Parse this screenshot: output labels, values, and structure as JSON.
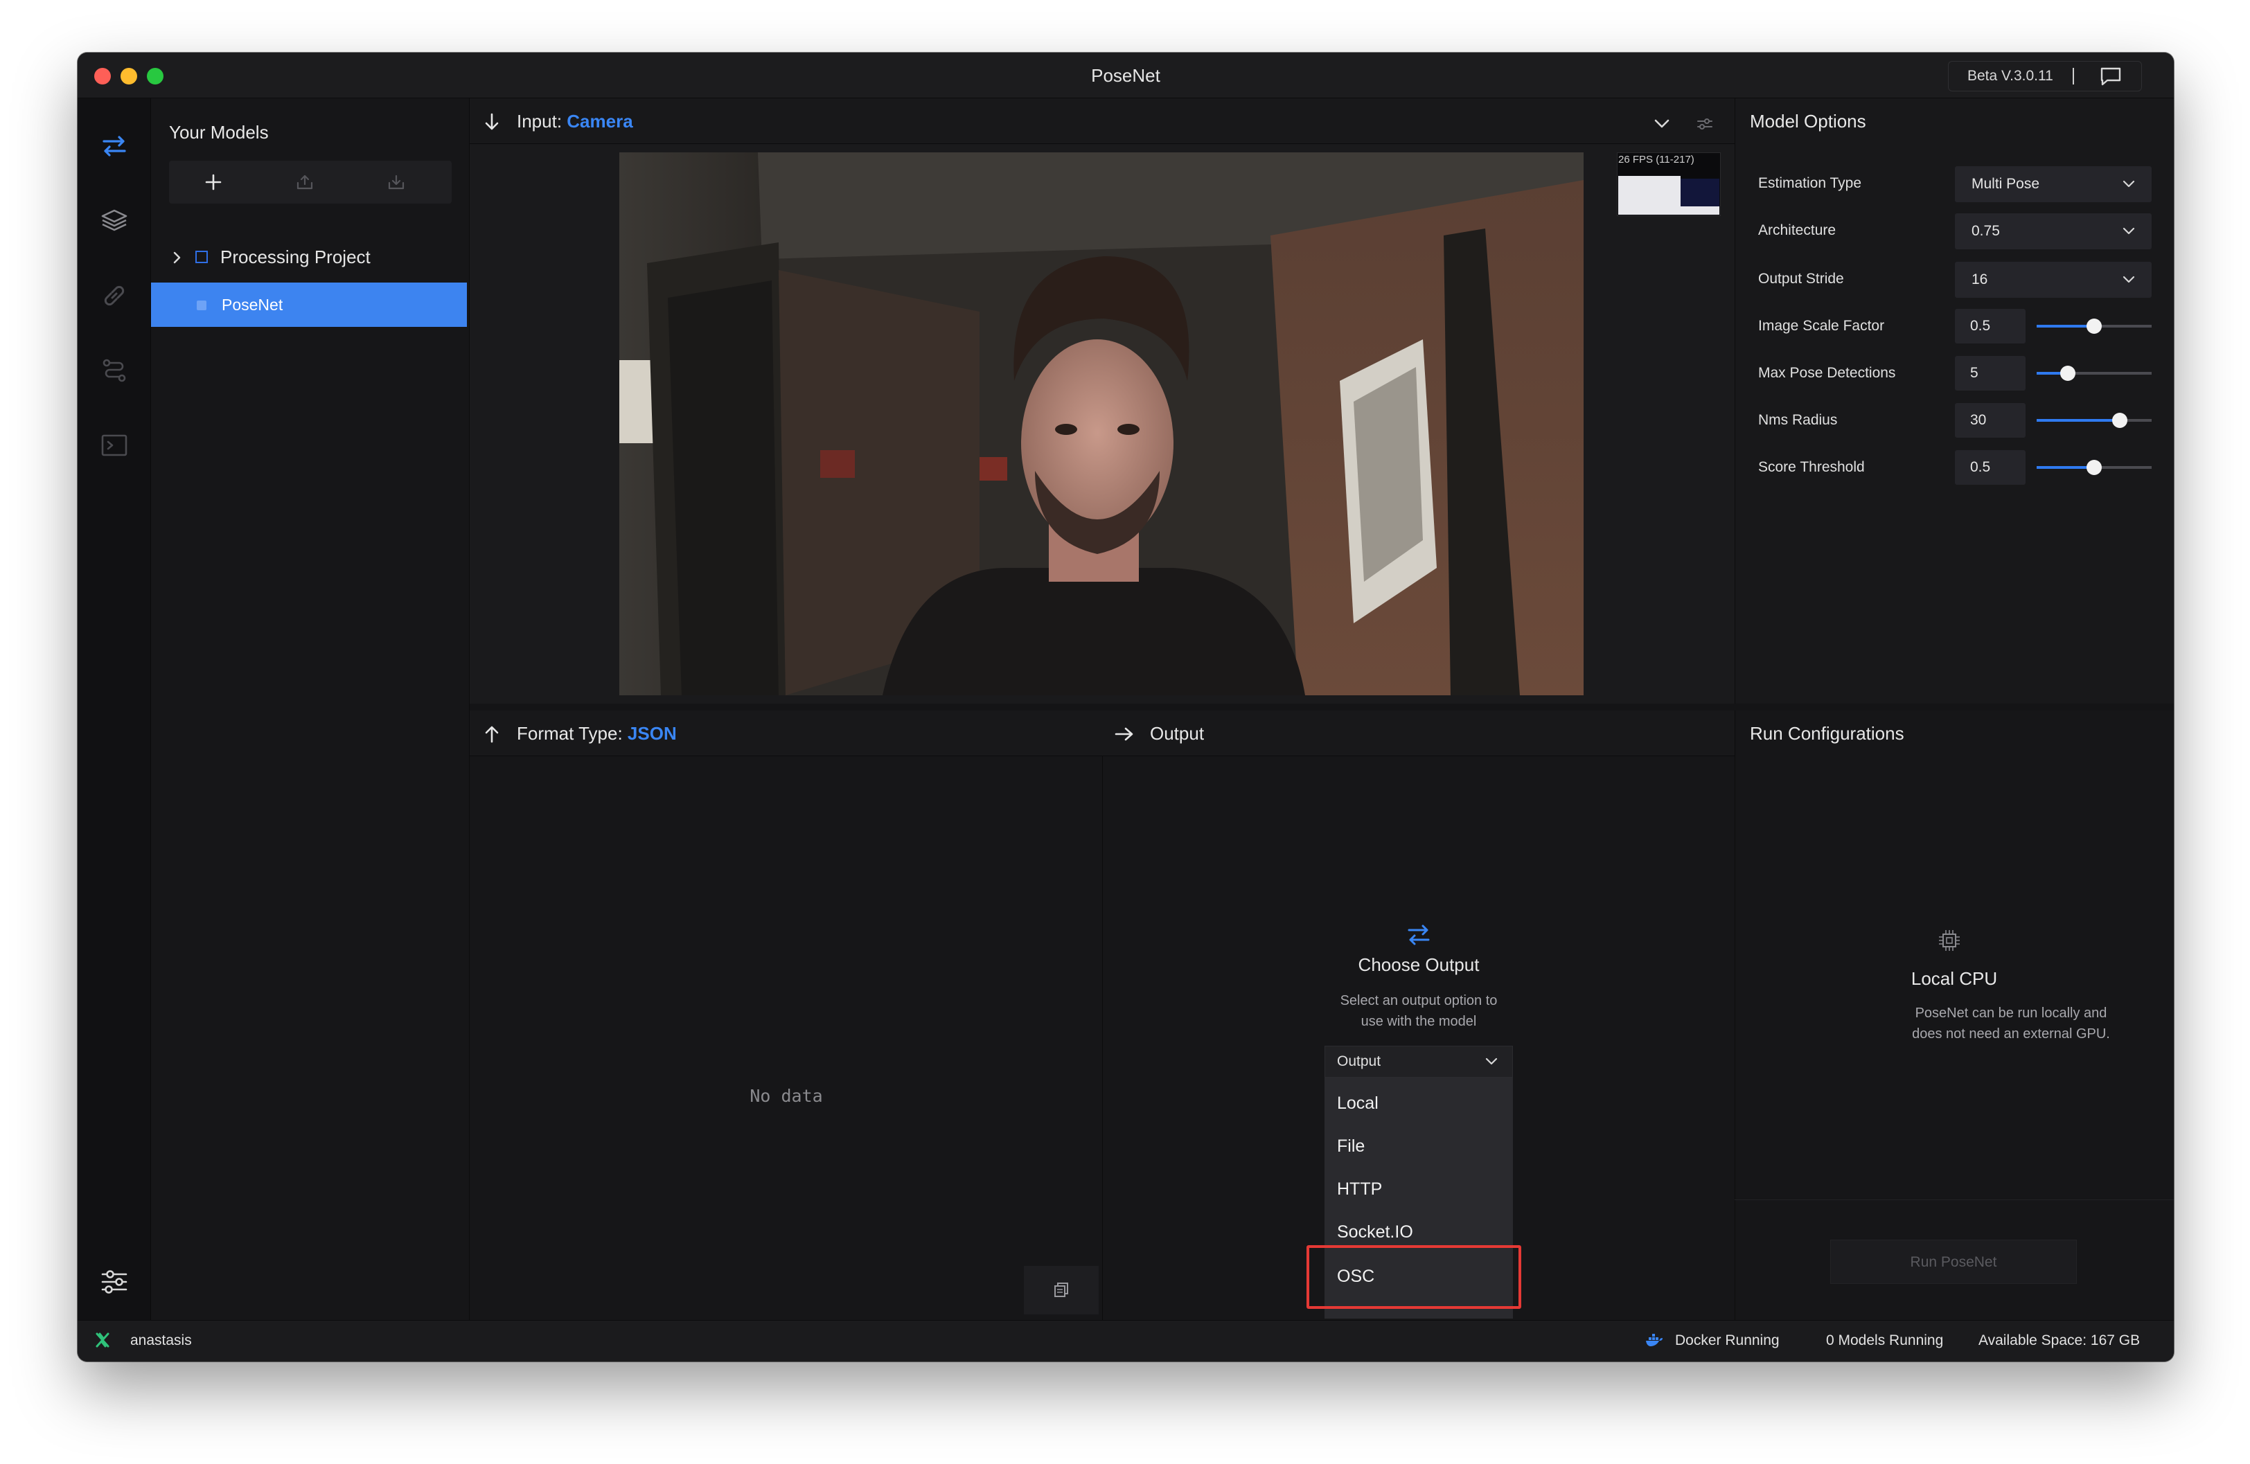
{
  "window": {
    "title": "PoseNet",
    "version": "Beta V.3.0.11"
  },
  "rail": {
    "icons": [
      "transfer-icon",
      "layers-icon",
      "link-icon",
      "route-icon",
      "terminal-icon",
      "settings-sliders-icon"
    ]
  },
  "sidebar": {
    "title": "Your Models",
    "project_label": "Processing Project",
    "model_label": "PoseNet"
  },
  "input": {
    "label_prefix": "Input: ",
    "source": "Camera",
    "fps_label": "26 FPS (11-217)"
  },
  "model_options": {
    "title": "Model Options",
    "estimation_type": {
      "label": "Estimation Type",
      "value": "Multi Pose"
    },
    "architecture": {
      "label": "Architecture",
      "value": "0.75"
    },
    "output_stride": {
      "label": "Output Stride",
      "value": "16"
    },
    "image_scale_factor": {
      "label": "Image Scale Factor",
      "value": "0.5",
      "slider_fraction": 0.5
    },
    "max_pose_detections": {
      "label": "Max Pose Detections",
      "value": "5",
      "slider_fraction": 0.27
    },
    "nms_radius": {
      "label": "Nms Radius",
      "value": "30",
      "slider_fraction": 0.72
    },
    "score_threshold": {
      "label": "Score Threshold",
      "value": "0.5",
      "slider_fraction": 0.5
    }
  },
  "format": {
    "label_prefix": "Format Type: ",
    "type": "JSON",
    "empty_text": "No data"
  },
  "output": {
    "header": "Output",
    "title": "Choose Output",
    "description": "Select an output option to use with the model",
    "dropdown_placeholder": "Output",
    "options": [
      "Local",
      "File",
      "HTTP",
      "Socket.IO",
      "OSC"
    ],
    "highlighted_option": "OSC"
  },
  "run_config": {
    "title": "Run Configurations",
    "cpu_title": "Local CPU",
    "cpu_desc": "PoseNet can be run locally and does not need an external GPU.",
    "run_button": "Run PoseNet"
  },
  "status": {
    "user": "anastasis",
    "docker": "Docker Running",
    "models_running": "0 Models Running",
    "available_space": "Available Space: 167 GB"
  },
  "colors": {
    "accent": "#3a86f4",
    "highlight_box": "#e53935",
    "close_dot": "#fe5f57",
    "minimize_dot": "#febc2e",
    "zoom_dot": "#28c840"
  }
}
